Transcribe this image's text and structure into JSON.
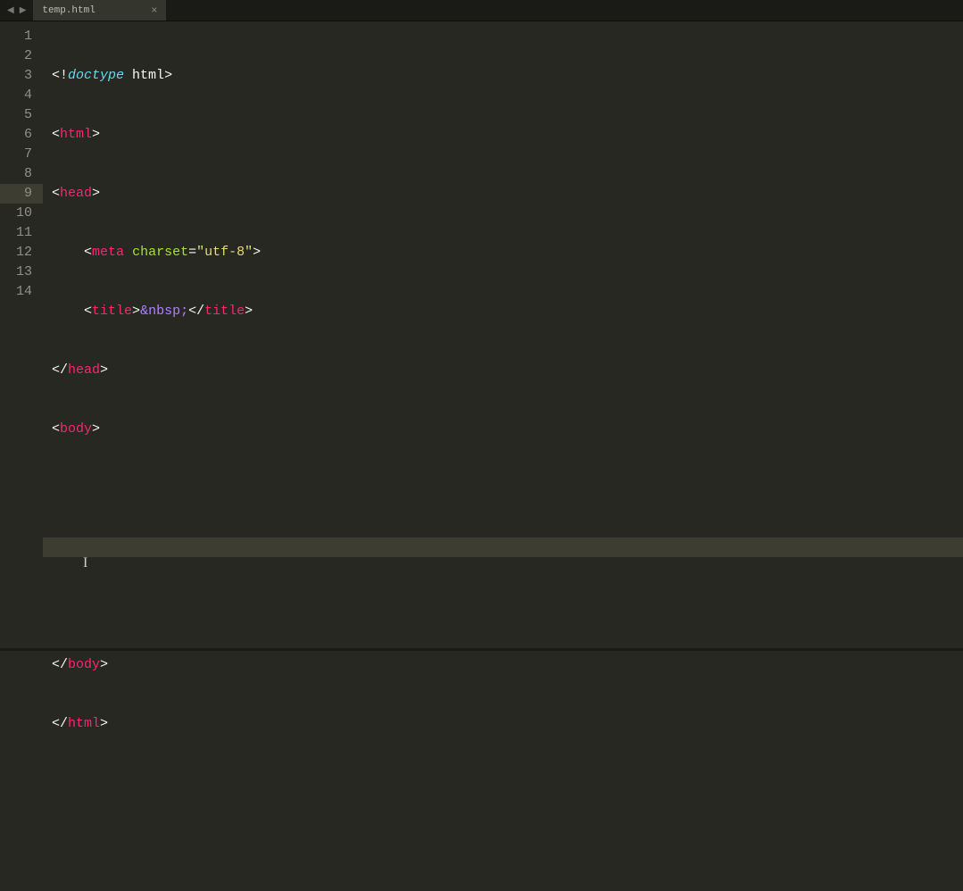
{
  "tab": {
    "filename": "temp.html",
    "close_glyph": "×"
  },
  "nav": {
    "back": "◀",
    "forward": "▶"
  },
  "gutter": {
    "line_numbers": [
      "1",
      "2",
      "3",
      "4",
      "5",
      "6",
      "7",
      "8",
      "9",
      "10",
      "11",
      "12",
      "13",
      "14"
    ],
    "selected_index": 8
  },
  "code": {
    "l1": {
      "p1": "<!",
      "decl": "doctype",
      "sp": " ",
      "kw": "html",
      "p2": ">"
    },
    "l2": {
      "p1": "<",
      "tag": "html",
      "p2": ">"
    },
    "l3": {
      "p1": "<",
      "tag": "head",
      "p2": ">"
    },
    "l4": {
      "indent": "    ",
      "p1": "<",
      "tag": "meta",
      "sp": " ",
      "attr": "charset",
      "eq": "=",
      "q1": "\"",
      "val": "utf-8",
      "q2": "\"",
      "p2": ">"
    },
    "l5": {
      "indent": "    ",
      "p1": "<",
      "tag": "title",
      "p2": ">",
      "ent": "&nbsp;",
      "p3": "</",
      "tag2": "title",
      "p4": ">"
    },
    "l6": {
      "p1": "</",
      "tag": "head",
      "p2": ">"
    },
    "l7": {
      "p1": "<",
      "tag": "body",
      "p2": ">"
    },
    "l8": {
      "blank": ""
    },
    "l9": {
      "blank": ""
    },
    "l10": {
      "blank": ""
    },
    "l11": {
      "p1": "</",
      "tag": "body",
      "p2": ">"
    },
    "l12": {
      "p1": "</",
      "tag": "html",
      "p2": ">"
    },
    "l13": {
      "blank": ""
    },
    "l14": {
      "blank": ""
    }
  }
}
